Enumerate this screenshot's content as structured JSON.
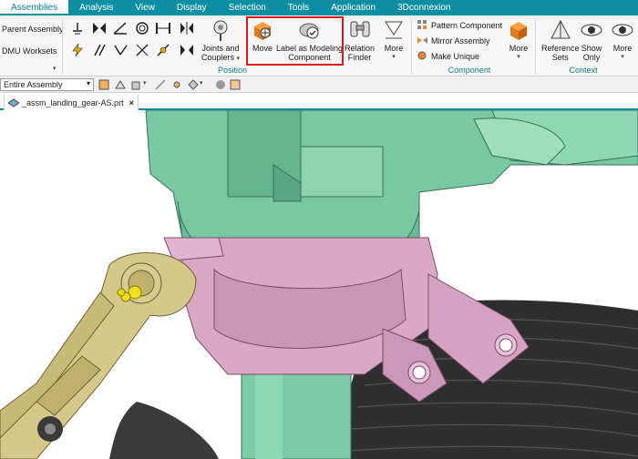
{
  "menubar": {
    "items": [
      "Assemblies",
      "Analysis",
      "View",
      "Display",
      "Selection",
      "Tools",
      "Application",
      "3Dconnexion"
    ],
    "active_index": 0
  },
  "ribbon": {
    "left_commands": [
      "Parent Assembly",
      "DMU Worksets"
    ],
    "joints": {
      "label_line1": "Joints and",
      "label_line2": "Couplers"
    },
    "move": {
      "label": "Move"
    },
    "label_modeling": {
      "label_line1": "Label as Modeling",
      "label_line2": "Component"
    },
    "relation_finder": {
      "label_line1": "Relation",
      "label_line2": "Finder"
    },
    "more1": {
      "label": "More"
    },
    "component_list": [
      "Pattern Component",
      "Mirror Assembly",
      "Make Unique"
    ],
    "more2": {
      "label": "More"
    },
    "reference_sets": {
      "label_line1": "Reference",
      "label_line2": "Sets"
    },
    "show_only": {
      "label_line1": "Show",
      "label_line2": "Only"
    },
    "more3": {
      "label": "More"
    },
    "groups": {
      "position": "Position",
      "component": "Component",
      "context": "Context"
    }
  },
  "toolbar2": {
    "scope_value": "Entire Assembly"
  },
  "tabs": {
    "document": "_assm_landing_gear-AS.prt",
    "close_glyph": "×"
  },
  "colors": {
    "menubar_bg": "#0e8ea3",
    "highlight": "#e0161c",
    "housing_green": "#78c8a4",
    "bracket_pink": "#d8a8c4",
    "arm_tan": "#d6c88a",
    "tire": "#2e2e2e"
  }
}
